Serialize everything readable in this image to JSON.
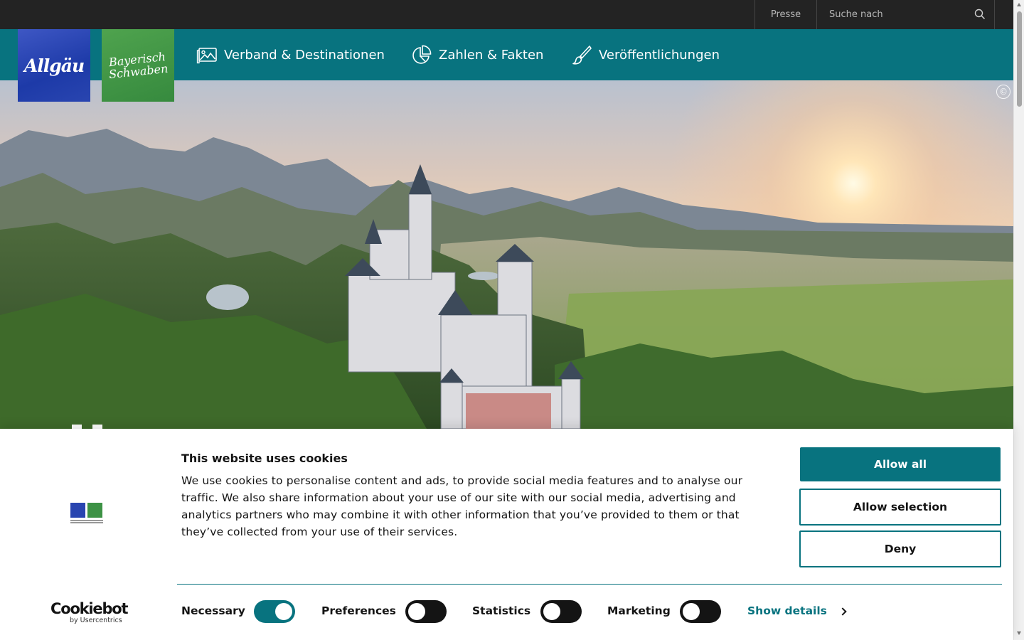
{
  "topbar": {
    "press_label": "Presse",
    "search_placeholder": "Suche nach",
    "search_icon": "search-icon"
  },
  "logos": {
    "allgaeu_text": "Allgäu",
    "bayerisch_schwaben_line1": "Bayerisch",
    "bayerisch_schwaben_line2": "Schwaben"
  },
  "nav": {
    "items": [
      {
        "label": "Verband & Destinationen",
        "icon": "picture-icon"
      },
      {
        "label": "Zahlen & Fakten",
        "icon": "pie-chart-icon"
      },
      {
        "label": "Veröffentlichungen",
        "icon": "brush-icon"
      }
    ]
  },
  "hero": {
    "copyright_symbol": "©",
    "pause_icon": "pause-icon"
  },
  "cookie_banner": {
    "title": "This website uses cookies",
    "text": "We use cookies to personalise content and ads, to provide social media features and to analyse our traffic. We also share information about your use of our site with our social media, advertising and analytics partners who may combine it with other information that you’ve provided to them or that they’ve collected from your use of their services.",
    "buttons": {
      "allow_all": "Allow all",
      "allow_selection": "Allow selection",
      "deny": "Deny"
    },
    "toggles": [
      {
        "label": "Necessary",
        "enabled": true
      },
      {
        "label": "Preferences",
        "enabled": false
      },
      {
        "label": "Statistics",
        "enabled": false
      },
      {
        "label": "Marketing",
        "enabled": false
      }
    ],
    "show_details": "Show details",
    "brand": {
      "name": "Cookiebot",
      "sub": "by Usercentrics"
    }
  },
  "colors": {
    "brand_teal": "#08737f",
    "topbar_dark": "#232323",
    "allgaeu_blue": "#2945b0",
    "schwaben_green": "#3d9245"
  }
}
